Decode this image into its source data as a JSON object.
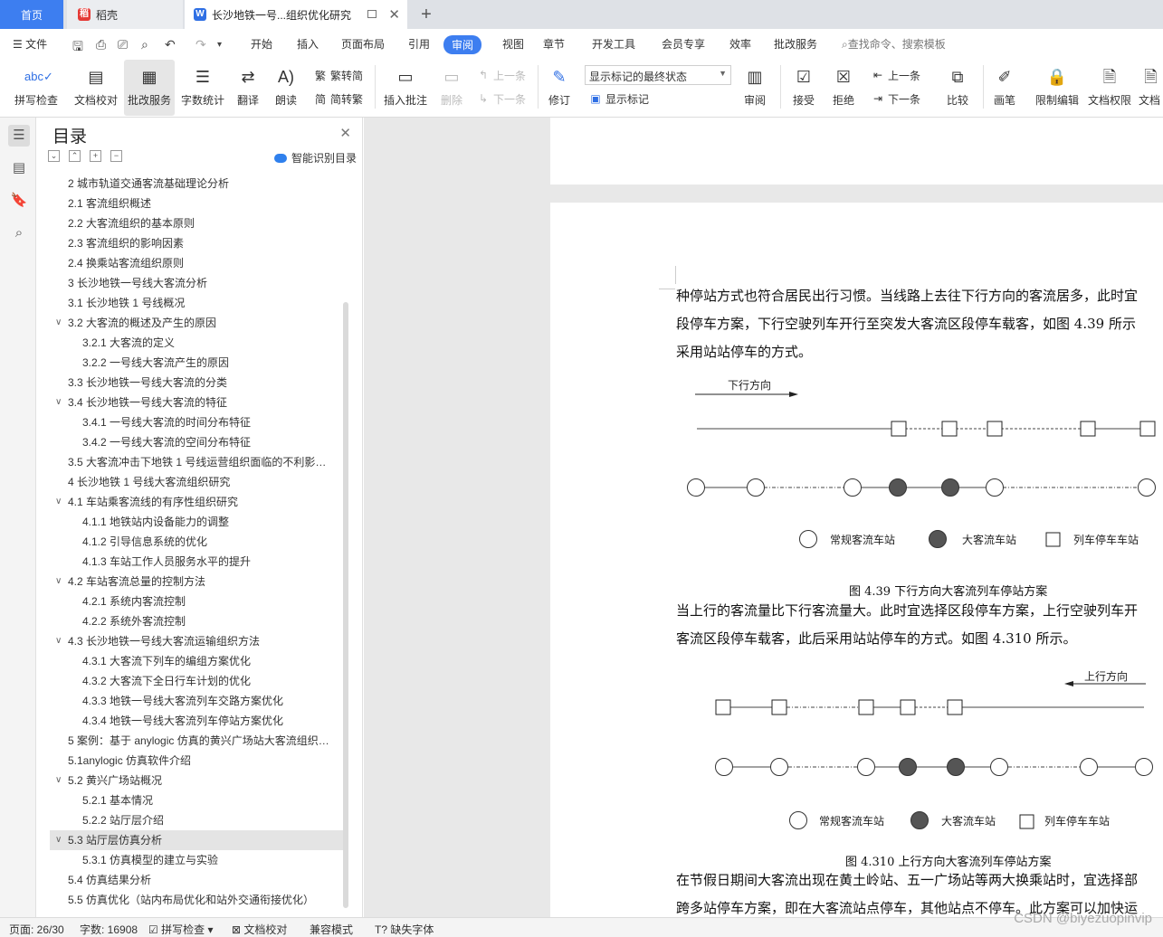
{
  "tabs": {
    "home": "首页",
    "daoke": "稻壳",
    "doc": "长沙地铁一号...组织优化研究"
  },
  "menu": {
    "file": "文件",
    "items": [
      "开始",
      "插入",
      "页面布局",
      "引用",
      "审阅",
      "视图",
      "章节",
      "开发工具",
      "会员专享",
      "效率",
      "批改服务"
    ],
    "active": "审阅",
    "search": "查找命令、搜索模板"
  },
  "ribbon": {
    "spell": "拼写检查",
    "doccheck": "文档校对",
    "correct": "批改服务",
    "wordcount": "字数统计",
    "translate": "翻译",
    "read": "朗读",
    "trad": "繁转简",
    "simp": "简转繁",
    "addcomment": "插入批注",
    "delete": "删除",
    "prev": "上一条",
    "next": "下一条",
    "revise": "修订",
    "markstate": "显示标记的最终状态",
    "showmark": "显示标记",
    "review": "审阅",
    "accept": "接受",
    "reject": "拒绝",
    "prev2": "上一条",
    "next2": "下一条",
    "compare": "比较",
    "pen": "画笔",
    "restrict": "限制编辑",
    "docperm": "文档权限",
    "docl": "文档"
  },
  "toc": {
    "title": "目录",
    "ai": "智能识别目录",
    "items": [
      {
        "text": "2 城市轨道交通客流基础理论分析",
        "level": 1
      },
      {
        "text": "2.1 客流组织概述",
        "level": 1
      },
      {
        "text": "2.2 大客流组织的基本原则",
        "level": 1
      },
      {
        "text": "2.3 客流组织的影响因素",
        "level": 1
      },
      {
        "text": "2.4 换乘站客流组织原则",
        "level": 1
      },
      {
        "text": "3 长沙地铁一号线大客流分析",
        "level": 1
      },
      {
        "text": "3.1 长沙地铁 1 号线概况",
        "level": 1
      },
      {
        "text": "3.2 大客流的概述及产生的原因",
        "level": 1,
        "exp": true
      },
      {
        "text": "3.2.1 大客流的定义",
        "level": 2
      },
      {
        "text": "3.2.2 一号线大客流产生的原因",
        "level": 2
      },
      {
        "text": "3.3 长沙地铁一号线大客流的分类",
        "level": 1
      },
      {
        "text": "3.4 长沙地铁一号线大客流的特征",
        "level": 1,
        "exp": true
      },
      {
        "text": "3.4.1 一号线大客流的时间分布特征",
        "level": 2
      },
      {
        "text": "3.4.2 一号线大客流的空间分布特征",
        "level": 2
      },
      {
        "text": "3.5 大客流冲击下地铁 1 号线运营组织面临的不利影…",
        "level": 1
      },
      {
        "text": "4 长沙地铁 1 号线大客流组织研究",
        "level": 1
      },
      {
        "text": "4.1 车站乘客流线的有序性组织研究",
        "level": 1,
        "exp": true
      },
      {
        "text": "4.1.1 地铁站内设备能力的调整",
        "level": 2
      },
      {
        "text": "4.1.2 引导信息系统的优化",
        "level": 2
      },
      {
        "text": "4.1.3 车站工作人员服务水平的提升",
        "level": 2
      },
      {
        "text": "4.2 车站客流总量的控制方法",
        "level": 1,
        "exp": true
      },
      {
        "text": "4.2.1 系统内客流控制",
        "level": 2
      },
      {
        "text": "4.2.2 系统外客流控制",
        "level": 2
      },
      {
        "text": "4.3 长沙地铁一号线大客流运输组织方法",
        "level": 1,
        "exp": true
      },
      {
        "text": "4.3.1 大客流下列车的编组方案优化",
        "level": 2
      },
      {
        "text": "4.3.2 大客流下全日行车计划的优化",
        "level": 2
      },
      {
        "text": "4.3.3 地铁一号线大客流列车交路方案优化",
        "level": 2
      },
      {
        "text": "4.3.4 地铁一号线大客流列车停站方案优化",
        "level": 2
      },
      {
        "text": "5 案例：基于 anylogic 仿真的黄兴广场站大客流组织…",
        "level": 1
      },
      {
        "text": "5.1anylogic 仿真软件介绍",
        "level": 1
      },
      {
        "text": "5.2 黄兴广场站概况",
        "level": 1,
        "exp": true
      },
      {
        "text": "5.2.1 基本情况",
        "level": 2
      },
      {
        "text": "5.2.2 站厅层介绍",
        "level": 2
      },
      {
        "text": "5.3 站厅层仿真分析",
        "level": 1,
        "exp": true,
        "sel": true
      },
      {
        "text": "5.3.1 仿真模型的建立与实验",
        "level": 2
      },
      {
        "text": "5.4 仿真结果分析",
        "level": 1
      },
      {
        "text": "5.5 仿真优化（站内布局优化和站外交通衔接优化）",
        "level": 1
      }
    ]
  },
  "doc": {
    "p1": [
      "种停站方式也符合居民出行习惯。当线路上去往下行方向的客流居多，此时宜",
      "段停车方案，下行空驶列车开行至突发大客流区段停车载客，如图 4.39 所示",
      "采用站站停车的方式。"
    ],
    "fig1_dir": "下行方向",
    "legend": {
      "normal": "常规客流车站",
      "big": "大客流车站",
      "stop": "列车停车车站"
    },
    "cap1": "图 4.39 下行方向大客流列车停站方案",
    "p2": [
      "当上行的客流量比下行客流量大。此时宜选择区段停车方案，上行空驶列车开",
      "客流区段停车载客，此后采用站站停车的方式。如图 4.310 所示。"
    ],
    "fig2_dir": "上行方向",
    "cap2": "图 4.310 上行方向大客流列车停站方案",
    "p3": [
      "在节假日期间大客流出现在黄土岭站、五一广场站等两大换乘站时，宜选择部",
      "跨多站停车方案，即在大客流站点停车，其他站点不停车。此方案可以加快运"
    ]
  },
  "status": {
    "page": "页面: 26/30",
    "words": "字数: 16908",
    "spell": "拼写检查",
    "check": "文档校对",
    "compat": "兼容模式",
    "font": "缺失字体"
  },
  "watermark": "CSDN @biyezuopinvip"
}
